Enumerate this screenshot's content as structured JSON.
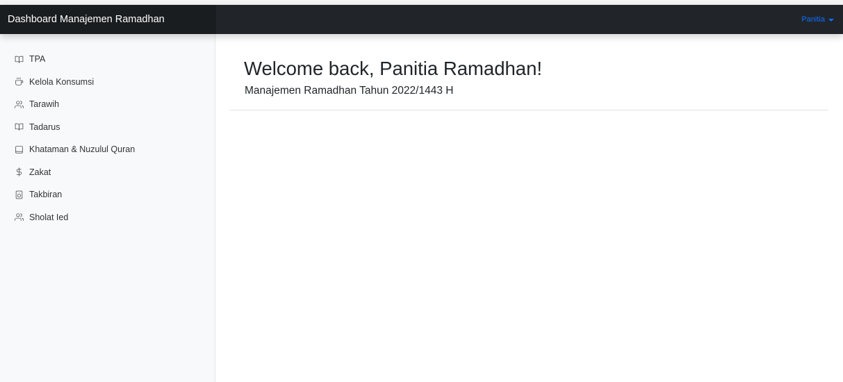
{
  "navbar": {
    "brand": "Dashboard Manajemen Ramadhan",
    "user": {
      "label": "Panitia",
      "icon": "caret-down-icon",
      "color": "#0d6efd"
    },
    "background": "#212529"
  },
  "sidebar": {
    "items": [
      {
        "label": "TPA",
        "icon": "book-open-icon"
      },
      {
        "label": "Kelola Konsumsi",
        "icon": "coffee-cup-icon"
      },
      {
        "label": "Tarawih",
        "icon": "users-icon"
      },
      {
        "label": "Tadarus",
        "icon": "book-open-icon"
      },
      {
        "label": "Khataman & Nuzulul Quran",
        "icon": "tablet-icon"
      },
      {
        "label": "Zakat",
        "icon": "dollar-sign-icon"
      },
      {
        "label": "Takbiran",
        "icon": "speaker-icon"
      },
      {
        "label": "Sholat Ied",
        "icon": "users-icon"
      }
    ]
  },
  "main": {
    "title": "Welcome back, Panitia Ramadhan!",
    "subtitle": "Manajemen Ramadhan Tahun 2022/1443 H"
  }
}
